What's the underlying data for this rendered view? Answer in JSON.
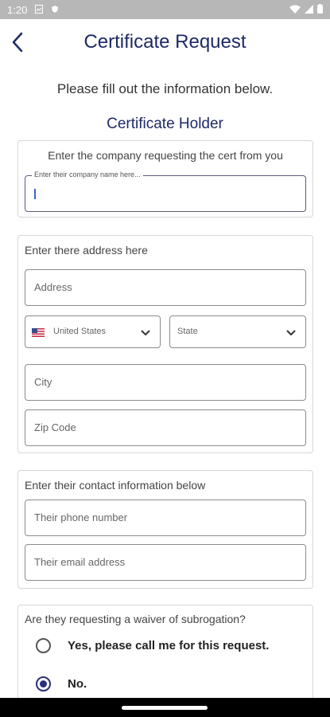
{
  "status_bar": {
    "time": "1:20"
  },
  "header": {
    "title": "Certificate Request"
  },
  "intro": {
    "text": "Please fill out the information below."
  },
  "section": {
    "title": "Certificate Holder"
  },
  "company": {
    "label": "Enter the company requesting the cert from you",
    "field_floating_label": "Enter their company name here..."
  },
  "address": {
    "label": "Enter there address here",
    "address_placeholder": "Address",
    "country_value": "United States",
    "state_placeholder": "State",
    "city_placeholder": "City",
    "zip_placeholder": "Zip Code"
  },
  "contact": {
    "label": "Enter their contact information below",
    "phone_placeholder": "Their phone number",
    "email_placeholder": "Their email address"
  },
  "waiver": {
    "question": "Are they requesting a waiver of subrogation?",
    "options": [
      {
        "label": "Yes, please call me for this request.",
        "checked": false
      },
      {
        "label": "No.",
        "checked": true
      }
    ]
  },
  "colors": {
    "primary": "#1e2a66",
    "radio_selected": "#2a2f7a",
    "caret": "#3b63d8"
  }
}
